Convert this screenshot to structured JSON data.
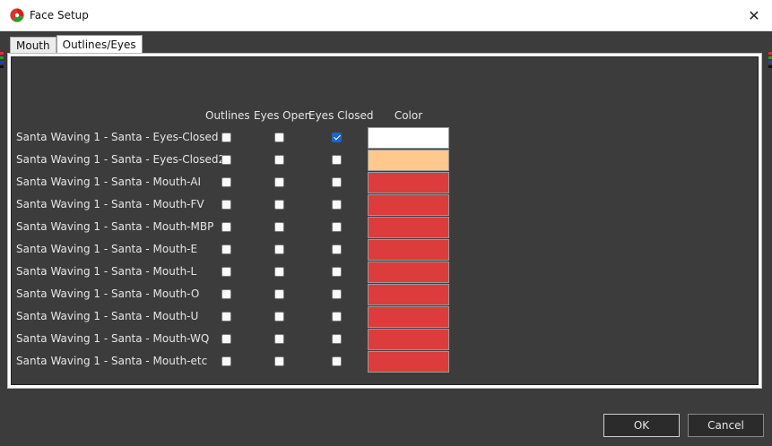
{
  "window": {
    "title": "Face Setup",
    "close_glyph": "✕"
  },
  "tabs": [
    {
      "label": "Mouth",
      "active": false
    },
    {
      "label": "Outlines/Eyes",
      "active": true
    }
  ],
  "columns": {
    "outlines": "Outlines",
    "eyes_open": "Eyes Open",
    "eyes_closed": "Eyes Closed",
    "color": "Color"
  },
  "rows": [
    {
      "label": "Santa Waving 1 - Santa - Eyes-Closed",
      "outlines": false,
      "eyes_open": false,
      "eyes_closed": true,
      "color": "#ffffff"
    },
    {
      "label": "Santa Waving 1 - Santa - Eyes-Closed2",
      "outlines": false,
      "eyes_open": false,
      "eyes_closed": false,
      "color": "#ffc88c"
    },
    {
      "label": "Santa Waving 1 - Santa - Mouth-AI",
      "outlines": false,
      "eyes_open": false,
      "eyes_closed": false,
      "color": "#dc3c3c"
    },
    {
      "label": "Santa Waving 1 - Santa - Mouth-FV",
      "outlines": false,
      "eyes_open": false,
      "eyes_closed": false,
      "color": "#dc3c3c"
    },
    {
      "label": "Santa Waving 1 - Santa - Mouth-MBP",
      "outlines": false,
      "eyes_open": false,
      "eyes_closed": false,
      "color": "#dc3c3c"
    },
    {
      "label": "Santa Waving 1 - Santa - Mouth-E",
      "outlines": false,
      "eyes_open": false,
      "eyes_closed": false,
      "color": "#dc3c3c"
    },
    {
      "label": "Santa Waving 1 - Santa - Mouth-L",
      "outlines": false,
      "eyes_open": false,
      "eyes_closed": false,
      "color": "#dc3c3c"
    },
    {
      "label": "Santa Waving 1 - Santa - Mouth-O",
      "outlines": false,
      "eyes_open": false,
      "eyes_closed": false,
      "color": "#dc3c3c"
    },
    {
      "label": "Santa Waving 1 - Santa - Mouth-U",
      "outlines": false,
      "eyes_open": false,
      "eyes_closed": false,
      "color": "#dc3c3c"
    },
    {
      "label": "Santa Waving 1 - Santa - Mouth-WQ",
      "outlines": false,
      "eyes_open": false,
      "eyes_closed": false,
      "color": "#dc3c3c"
    },
    {
      "label": "Santa Waving 1 - Santa - Mouth-etc",
      "outlines": false,
      "eyes_open": false,
      "eyes_closed": false,
      "color": "#dc3c3c"
    }
  ],
  "buttons": {
    "ok": "OK",
    "cancel": "Cancel"
  },
  "colors": {
    "accent": "#1e64c8",
    "background": "#3c3c3c"
  },
  "icons": {
    "app": "xlights-app-icon",
    "close": "close-icon"
  }
}
